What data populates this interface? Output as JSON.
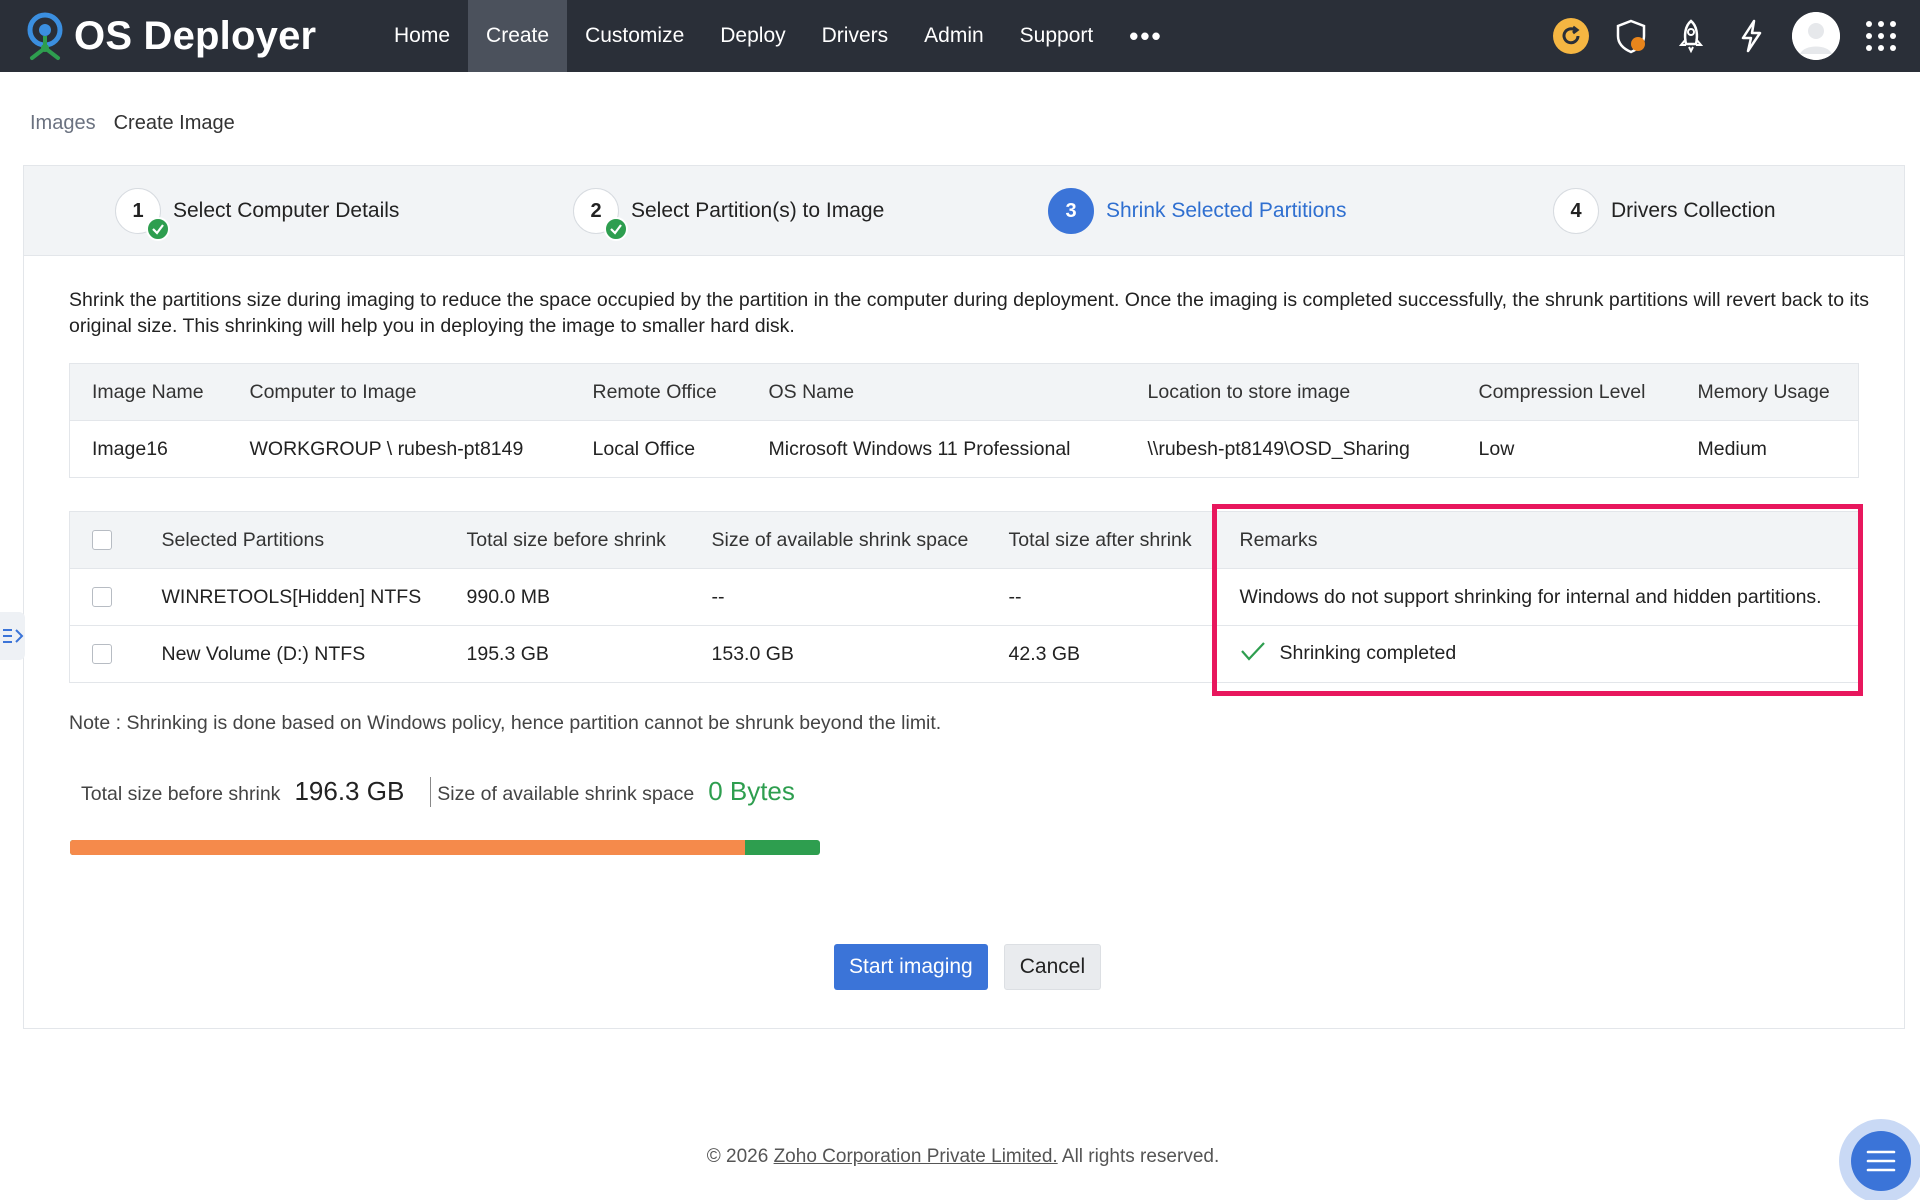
{
  "app": {
    "name": "OS Deployer"
  },
  "nav": {
    "items": [
      "Home",
      "Create",
      "Customize",
      "Deploy",
      "Drivers",
      "Admin",
      "Support"
    ],
    "active": "Create",
    "more": "•••"
  },
  "top_icons": [
    "refresh-icon",
    "shield-icon",
    "rocket-icon",
    "lightning-icon",
    "avatar",
    "apps-grid-icon"
  ],
  "breadcrumb": {
    "parent": "Images",
    "current": "Create Image"
  },
  "steps": [
    {
      "number": "1",
      "label": "Select Computer Details",
      "status": "done"
    },
    {
      "number": "2",
      "label": "Select Partition(s) to Image",
      "status": "done"
    },
    {
      "number": "3",
      "label": "Shrink Selected Partitions",
      "status": "current"
    },
    {
      "number": "4",
      "label": "Drivers Collection",
      "status": "pending"
    }
  ],
  "description": "Shrink the partitions size during imaging to reduce the space occupied by the partition in the computer during deployment. Once the imaging is completed successfully, the shrunk partitions will revert back to its original size. This shrinking will help you in deploying the image to smaller hard disk.",
  "image_info": {
    "headers": [
      "Image Name",
      "Computer to Image",
      "Remote Office",
      "OS Name",
      "Location to store image",
      "Compression Level",
      "Memory Usage"
    ],
    "row": [
      "Image16",
      "WORKGROUP \\ rubesh-pt8149",
      "Local Office",
      "Microsoft Windows 11 Professional",
      "\\\\rubesh-pt8149\\OSD_Sharing",
      "Low",
      "Medium"
    ]
  },
  "partitions": {
    "headers": [
      "Selected Partitions",
      "Total size before shrink",
      "Size of available shrink space",
      "Total size after shrink",
      "Remarks"
    ],
    "rows": [
      {
        "name": "WINRETOOLS[Hidden] NTFS",
        "before": "990.0 MB",
        "available": "--",
        "after": "--",
        "remarks": "Windows do not support shrinking for internal and hidden partitions.",
        "success": false
      },
      {
        "name": "New Volume (D:) NTFS",
        "before": "195.3 GB",
        "available": "153.0 GB",
        "after": "42.3 GB",
        "remarks": "Shrinking completed",
        "success": true
      }
    ]
  },
  "note": "Note : Shrinking is done based on Windows policy, hence partition cannot be shrunk beyond the limit.",
  "summary": {
    "total_label": "Total size before shrink",
    "total_value": "196.3 GB",
    "available_label": "Size of available shrink space",
    "available_value": "0 Bytes",
    "bar_fill_fraction": 0.9
  },
  "actions": {
    "start": "Start imaging",
    "cancel": "Cancel"
  },
  "footer": {
    "prefix": "© 2026 ",
    "link": "Zoho Corporation Private Limited.",
    "suffix": " All rights reserved."
  },
  "colors": {
    "topbar": "#2a2f38",
    "accent": "#3b74d8",
    "success": "#2e9e4f",
    "highlight": "#e8175d",
    "bar_orange": "#f58a4b"
  }
}
